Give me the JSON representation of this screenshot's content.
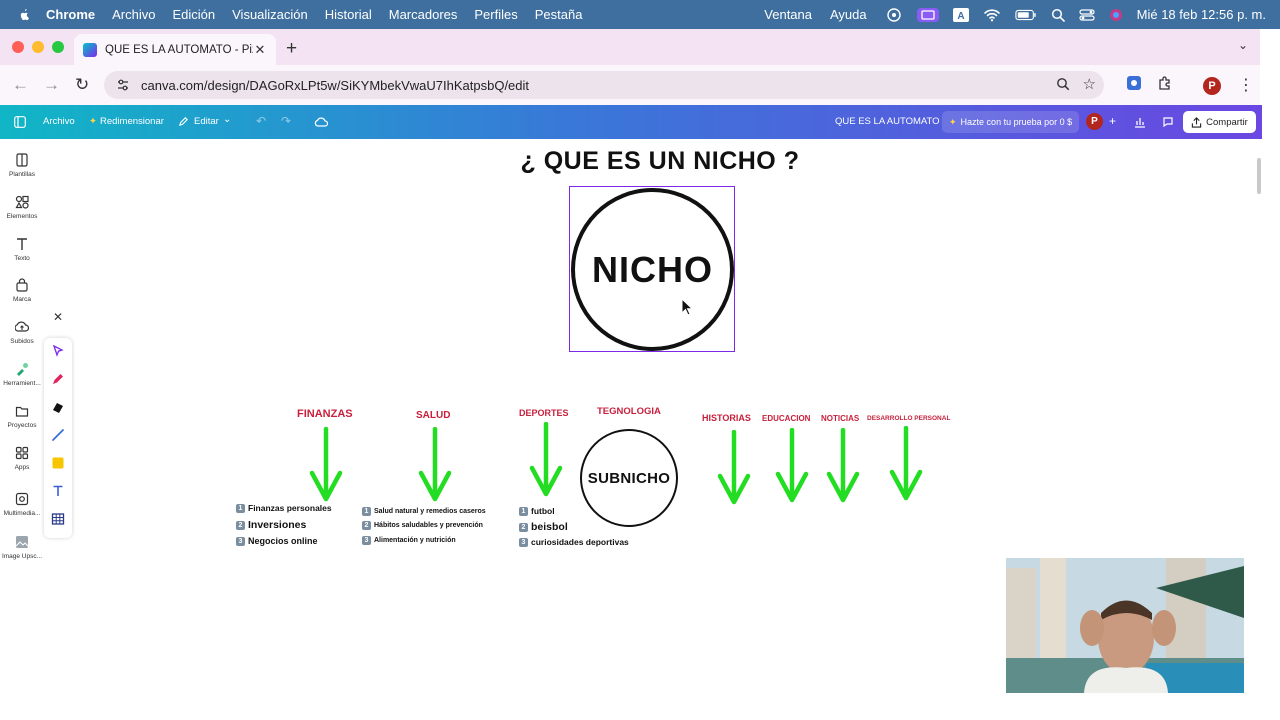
{
  "menubar": {
    "app": "Chrome",
    "items": [
      "Archivo",
      "Edición",
      "Visualización",
      "Historial",
      "Marcadores",
      "Perfiles",
      "Pestaña"
    ],
    "right_items": [
      "Ventana",
      "Ayuda"
    ],
    "clock": "Mié 18 feb 12:56 p. m."
  },
  "browser": {
    "tab_title": "QUE ES LA AUTOMATO - Piza",
    "url": "canva.com/design/DAGoRxLPt5w/SiKYMbekVwaU7IhKatpsbQ/edit",
    "profile_initial": "P"
  },
  "canva_topbar": {
    "file": "Archivo",
    "resize": "Redimensionar",
    "edit": "Editar",
    "doc_title": "QUE ES LA AUTOMATO",
    "try": "Hazte con tu prueba por 0 $",
    "avatar": "P",
    "share": "Compartir"
  },
  "sidebar": {
    "items": [
      {
        "label": "Plantillas",
        "icon": "templates-icon"
      },
      {
        "label": "Elementos",
        "icon": "elements-icon"
      },
      {
        "label": "Texto",
        "icon": "text-icon"
      },
      {
        "label": "Marca",
        "icon": "brand-icon"
      },
      {
        "label": "Subidos",
        "icon": "uploads-icon"
      },
      {
        "label": "Herramient...",
        "icon": "tools-icon"
      },
      {
        "label": "Proyectos",
        "icon": "projects-icon"
      },
      {
        "label": "Apps",
        "icon": "apps-icon"
      },
      {
        "label": "Multimedia...",
        "icon": "multimedia-icon"
      },
      {
        "label": "Image Upsc...",
        "icon": "image-upscaler-icon"
      }
    ]
  },
  "canvas": {
    "title": "¿ QUE ES UN NICHO ?",
    "center": "NICHO",
    "subnicho": "SUBNICHO",
    "categories": {
      "finanzas": "FINANZAS",
      "salud": "SALUD",
      "deportes": "DEPORTES",
      "tecnologia": "TEGNOLOGIA",
      "historias": "HISTORIAS",
      "educacion": "EDUCACION",
      "noticias": "NOTICIAS",
      "desarrollo": "DESARROLLO PERSONAL"
    },
    "finanzas_items": [
      "Finanzas personales",
      "Inversiones",
      "Negocios online"
    ],
    "salud_items": [
      "Salud natural y remedios caseros",
      "Hábitos saludables y prevención",
      "Alimentación y nutrición"
    ],
    "deportes_items": [
      "futbol",
      "beisbol",
      "curiosidades deportivas"
    ],
    "item_numbers": [
      "1",
      "2",
      "3"
    ]
  },
  "colors": {
    "category_red": "#c8203c",
    "arrow_green": "#22dd22",
    "canva_purple": "#7d2ae8",
    "canva_teal": "#10b6c6"
  }
}
